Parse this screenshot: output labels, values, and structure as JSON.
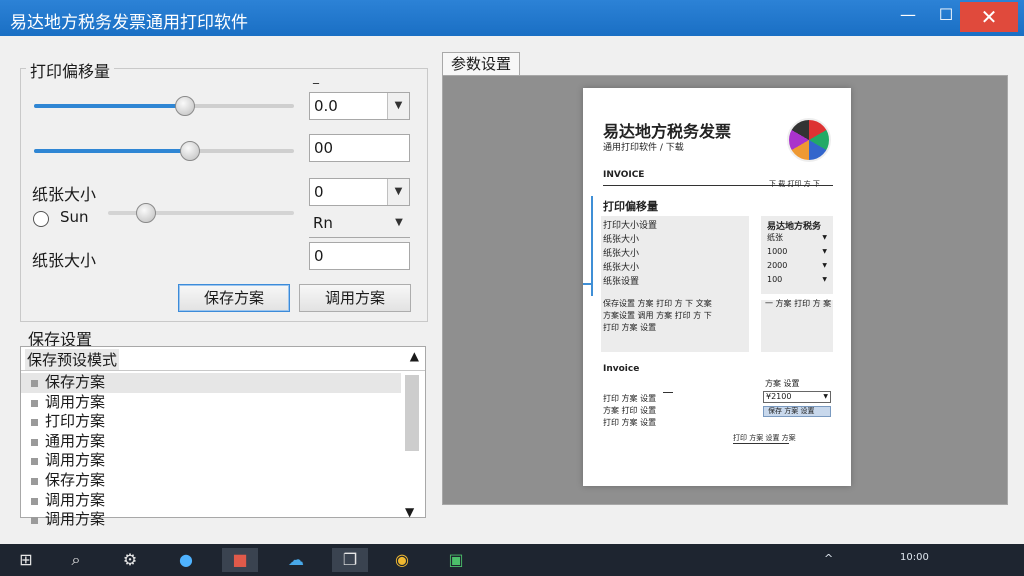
{
  "window": {
    "title": "易达地方税务发票通用打印软件",
    "min": "—",
    "max": "☐",
    "close": "✕"
  },
  "offset_group": {
    "legend": "打印偏移量",
    "dash": "_",
    "slider1_value": 0.58,
    "slider2_value": 0.6,
    "slider3_value": 0.2,
    "field1": "0.0",
    "field2": "00",
    "field3": "0",
    "field4": "Rn",
    "field5": "0",
    "paper_size_label_1": "纸张大小",
    "radio_label": "Sun",
    "paper_size_label_2": "纸张大小",
    "save_button": "保存方案",
    "load_button": "调用方案"
  },
  "save_group": {
    "legend": "保存设置",
    "list_header": "保存预设模式",
    "items": [
      "保存方案",
      "调用方案",
      "打印方案",
      "通用方案",
      "调用方案",
      "保存方案",
      "调用方案",
      "调用方案"
    ],
    "selected_index": 0
  },
  "preview": {
    "tab_label": "参数设置",
    "paper": {
      "title": "易达地方税务发票",
      "subtitle": "通用打印软件 / 下载",
      "invoice_heading": "INVOICE",
      "right_small": "下 载 打印 方 下",
      "offset_heading": "打印偏移量",
      "offset_rows": [
        "打印大小设置",
        "纸张大小",
        "纸张大小",
        "纸张大小",
        "纸张设置"
      ],
      "right_heading": "易达地方税务",
      "right_rows": [
        "纸张",
        "1000",
        "2000",
        "100"
      ],
      "notes": [
        "保存设置 方案 打印 方 下 文案",
        "方案设置 调用 方案 打印 方 下",
        "打印 方案 设置"
      ],
      "right_note": "一 方案 打印 方 案",
      "invoice2": "Invoice",
      "small_rows": [
        "打印 方案 设置",
        "方案 打印 设置",
        "打印 方案 设置"
      ],
      "right_label": "方案 设置",
      "right_select": "¥2100",
      "right_btn": "保存 方案 设置",
      "footer": "打印 方案 设置 方案"
    }
  },
  "taskbar": {
    "icons": [
      "windows-icon",
      "search-icon",
      "settings-icon",
      "edge-icon",
      "store-icon",
      "cloud-icon",
      "taskview-icon",
      "chrome-icon",
      "app-icon"
    ],
    "tray_left": "^",
    "tray_time": "10:00"
  }
}
